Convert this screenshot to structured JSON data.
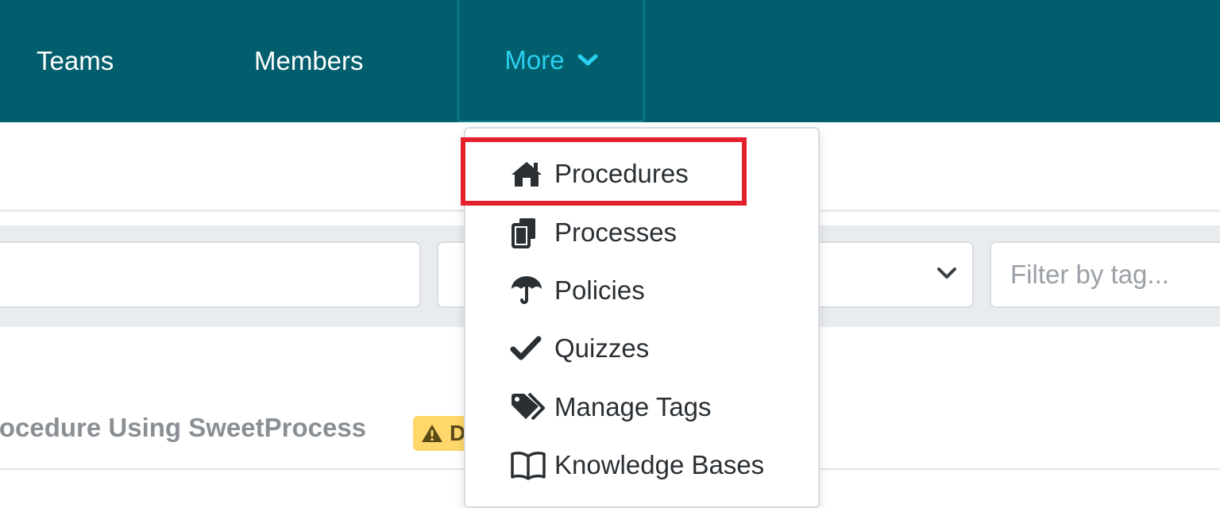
{
  "nav": {
    "teams": "Teams",
    "members": "Members",
    "more": "More"
  },
  "filters": {
    "search_value": "",
    "select_value": "",
    "tag_placeholder": "Filter by tag..."
  },
  "list": {
    "title": "rocedure Using SweetProcess",
    "badge": "D"
  },
  "dropdown": {
    "items": [
      {
        "label": "Procedures",
        "icon": "home-icon"
      },
      {
        "label": "Processes",
        "icon": "copy-icon"
      },
      {
        "label": "Policies",
        "icon": "umbrella-icon"
      },
      {
        "label": "Quizzes",
        "icon": "check-icon"
      },
      {
        "label": "Manage Tags",
        "icon": "tags-icon"
      },
      {
        "label": "Knowledge Bases",
        "icon": "book-icon"
      }
    ]
  },
  "colors": {
    "navbar": "#025e6c",
    "nav_active": "#2ad0ee",
    "highlight": "#e4202c",
    "badge": "#ffd76a"
  }
}
